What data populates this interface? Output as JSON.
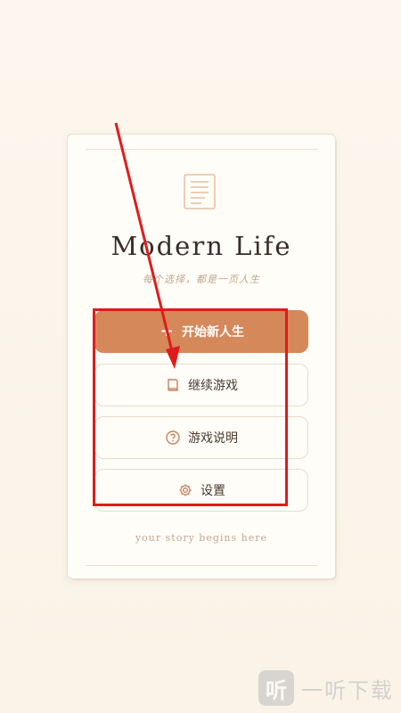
{
  "app": {
    "title": "Modern Life",
    "subtitle": "每个选择，都是一页人生",
    "footer": "your story begins here"
  },
  "menu": {
    "start_label": "开始新人生",
    "continue_label": "继续游戏",
    "help_label": "游戏说明",
    "settings_label": "设置"
  },
  "icons": {
    "document": "document-icon",
    "plus": "plus-icon",
    "book": "book-icon",
    "help": "help-circle-icon",
    "settings": "gear-icon"
  },
  "watermark": {
    "logo_char": "听",
    "text": "一听下载"
  },
  "colors": {
    "background": "#fbf4ea",
    "card": "#fffdf8",
    "primary": "#d5885a",
    "accent_text": "#c2a58d",
    "annotation": "#e11b1b"
  }
}
